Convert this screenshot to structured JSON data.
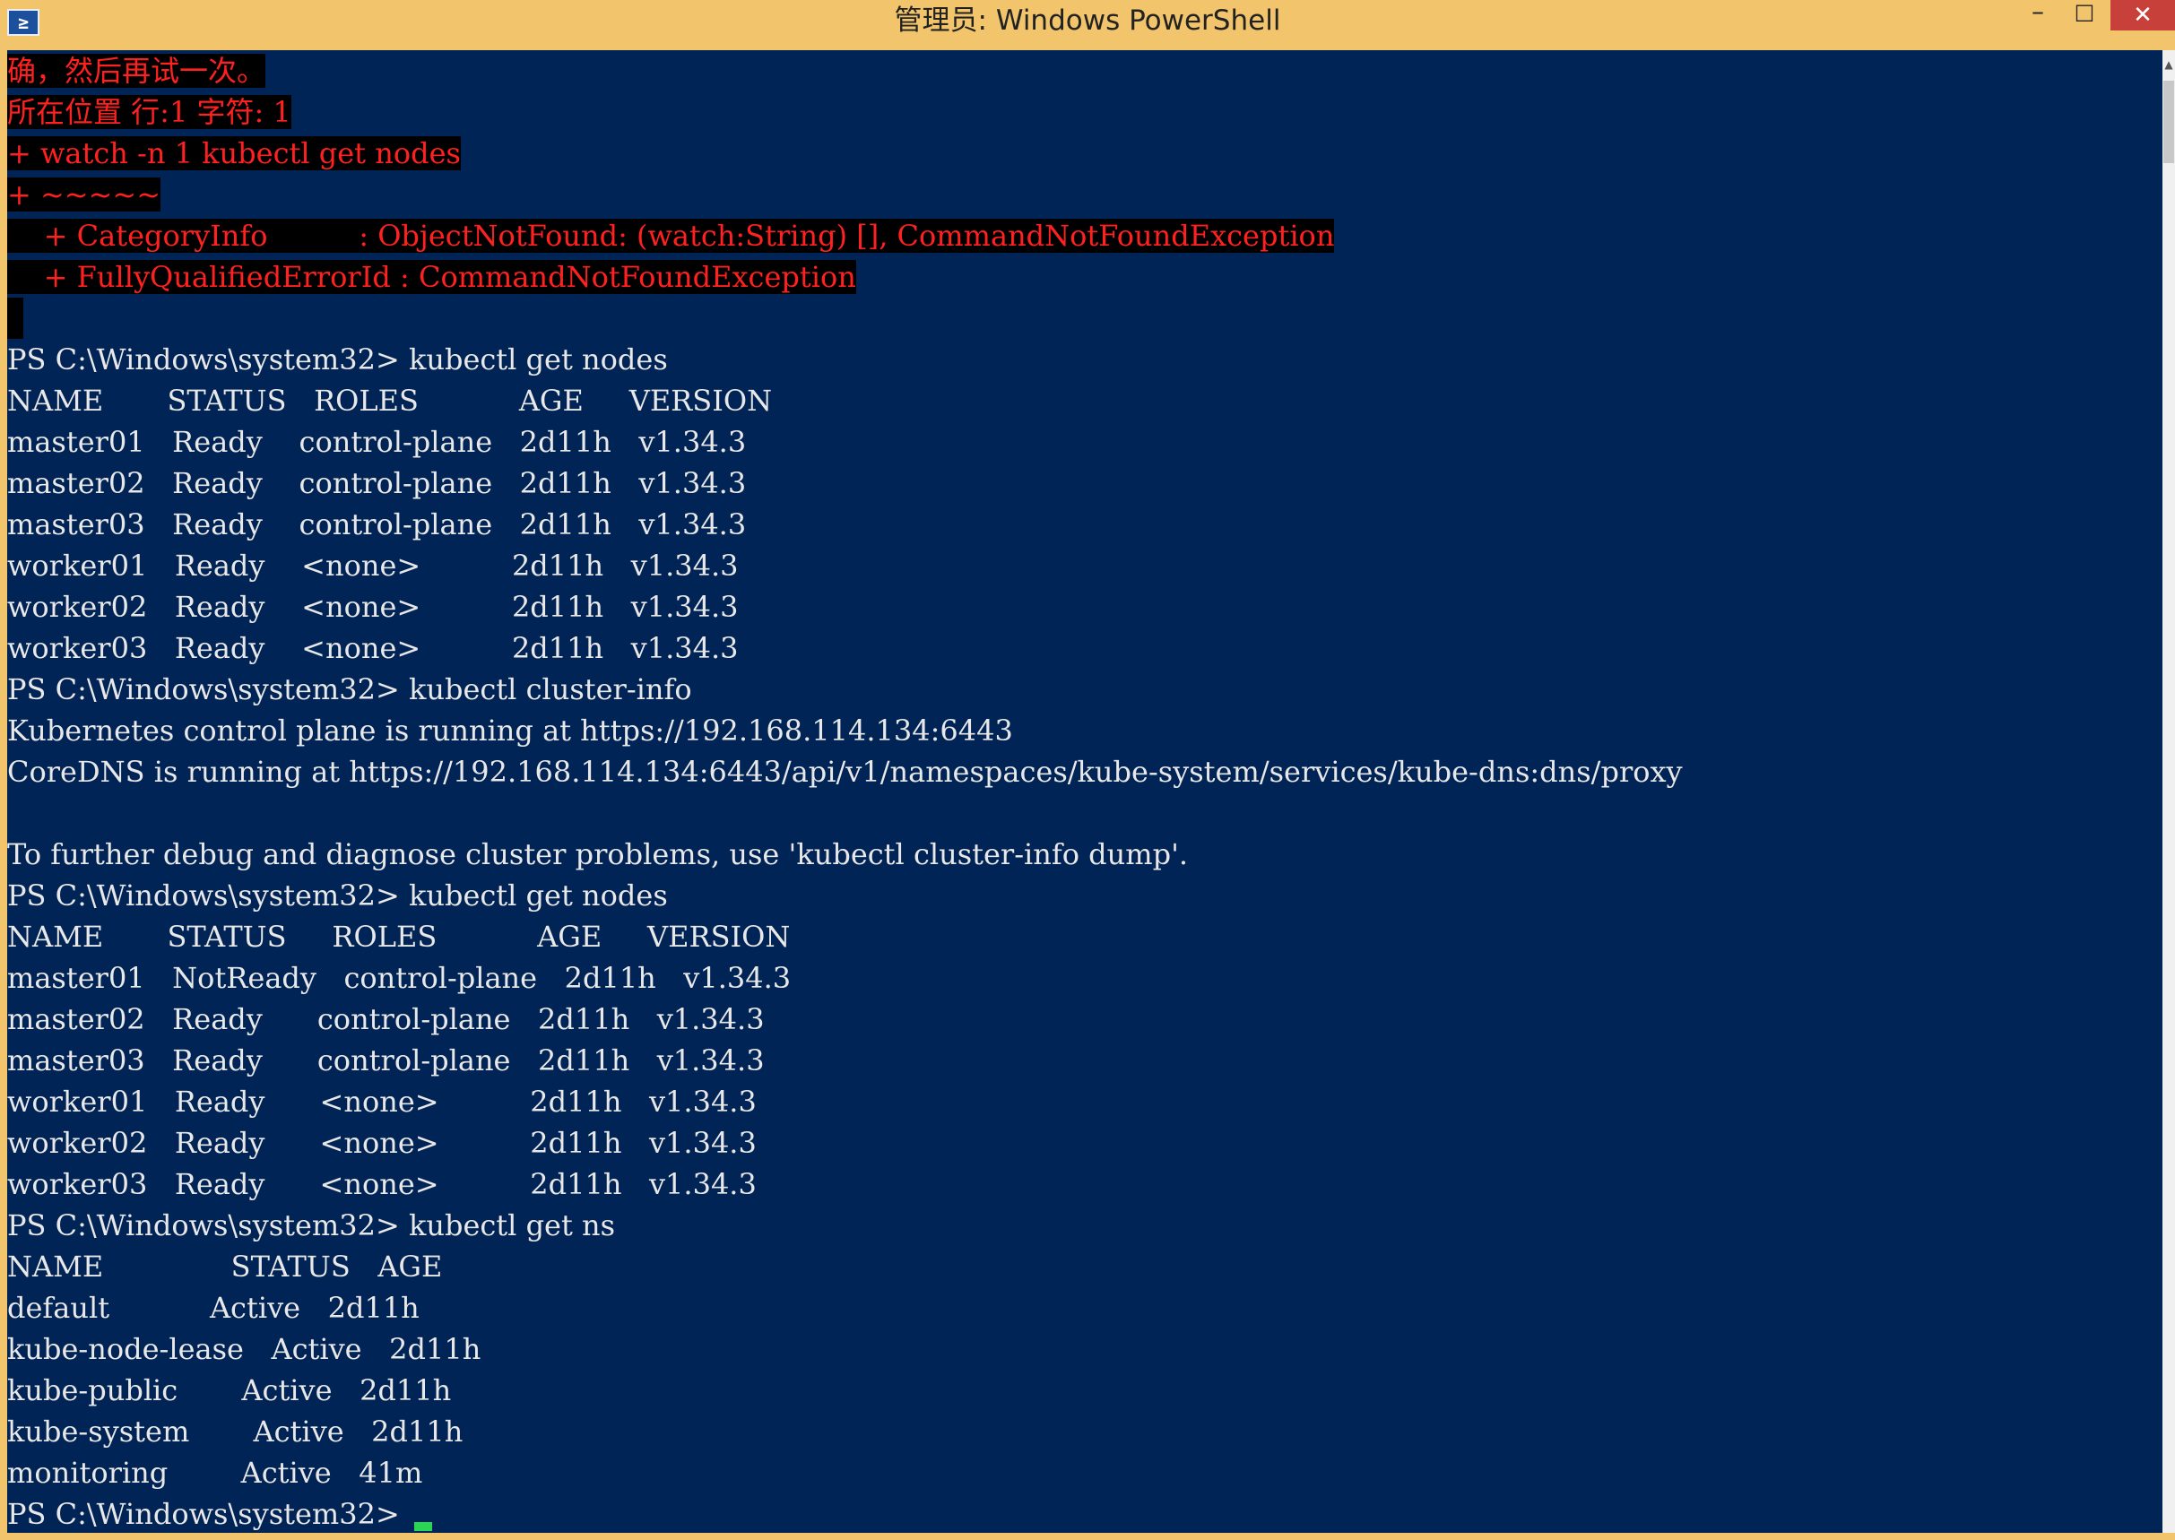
{
  "window": {
    "title": "管理员: Windows PowerShell",
    "icon_glyph": "≥",
    "icon": "powershell-icon",
    "minimize_glyph": "–",
    "maximize_glyph": "□",
    "close_glyph": "✕"
  },
  "colors": {
    "console_background": "#012456",
    "console_text": "#e8e8e8",
    "error_text": "#ff2020",
    "error_background": "#000000",
    "titlebar": "#f2c46b",
    "close_button": "#c7413a",
    "cursor": "#2bd456"
  },
  "console": {
    "lines": [
      {
        "text": "确，然后再试一次。",
        "type": "error"
      },
      {
        "text": "所在位置 行:1 字符: 1",
        "type": "error"
      },
      {
        "text": "+ watch -n 1 kubectl get nodes",
        "type": "error"
      },
      {
        "text": "+ ~~~~~",
        "type": "error"
      },
      {
        "text": "    + CategoryInfo          : ObjectNotFound: (watch:String) [], CommandNotFoundException",
        "type": "error"
      },
      {
        "text": "    + FullyQualifiedErrorId : CommandNotFoundException",
        "type": "error"
      },
      {
        "text": "",
        "type": "error-blank"
      },
      {
        "text": "PS C:\\Windows\\system32> kubectl get nodes",
        "type": "normal"
      },
      {
        "text": "NAME       STATUS   ROLES           AGE     VERSION",
        "type": "normal"
      },
      {
        "text": "master01   Ready    control-plane   2d11h   v1.34.3",
        "type": "normal"
      },
      {
        "text": "master02   Ready    control-plane   2d11h   v1.34.3",
        "type": "normal"
      },
      {
        "text": "master03   Ready    control-plane   2d11h   v1.34.3",
        "type": "normal"
      },
      {
        "text": "worker01   Ready    <none>          2d11h   v1.34.3",
        "type": "normal"
      },
      {
        "text": "worker02   Ready    <none>          2d11h   v1.34.3",
        "type": "normal"
      },
      {
        "text": "worker03   Ready    <none>          2d11h   v1.34.3",
        "type": "normal"
      },
      {
        "text": "PS C:\\Windows\\system32> kubectl cluster-info",
        "type": "normal"
      },
      {
        "text": "Kubernetes control plane is running at https://192.168.114.134:6443",
        "type": "normal"
      },
      {
        "text": "CoreDNS is running at https://192.168.114.134:6443/api/v1/namespaces/kube-system/services/kube-dns:dns/proxy",
        "type": "normal"
      },
      {
        "text": "",
        "type": "normal"
      },
      {
        "text": "To further debug and diagnose cluster problems, use 'kubectl cluster-info dump'.",
        "type": "normal"
      },
      {
        "text": "PS C:\\Windows\\system32> kubectl get nodes",
        "type": "normal"
      },
      {
        "text": "NAME       STATUS     ROLES           AGE     VERSION",
        "type": "normal"
      },
      {
        "text": "master01   NotReady   control-plane   2d11h   v1.34.3",
        "type": "normal"
      },
      {
        "text": "master02   Ready      control-plane   2d11h   v1.34.3",
        "type": "normal"
      },
      {
        "text": "master03   Ready      control-plane   2d11h   v1.34.3",
        "type": "normal"
      },
      {
        "text": "worker01   Ready      <none>          2d11h   v1.34.3",
        "type": "normal"
      },
      {
        "text": "worker02   Ready      <none>          2d11h   v1.34.3",
        "type": "normal"
      },
      {
        "text": "worker03   Ready      <none>          2d11h   v1.34.3",
        "type": "normal"
      },
      {
        "text": "PS C:\\Windows\\system32> kubectl get ns",
        "type": "normal"
      },
      {
        "text": "NAME              STATUS   AGE",
        "type": "normal"
      },
      {
        "text": "default           Active   2d11h",
        "type": "normal"
      },
      {
        "text": "kube-node-lease   Active   2d11h",
        "type": "normal"
      },
      {
        "text": "kube-public       Active   2d11h",
        "type": "normal"
      },
      {
        "text": "kube-system       Active   2d11h",
        "type": "normal"
      },
      {
        "text": "monitoring        Active   41m",
        "type": "normal"
      }
    ],
    "prompt": "PS C:\\Windows\\system32>"
  },
  "scrollbar": {
    "up_glyph": "▲"
  }
}
